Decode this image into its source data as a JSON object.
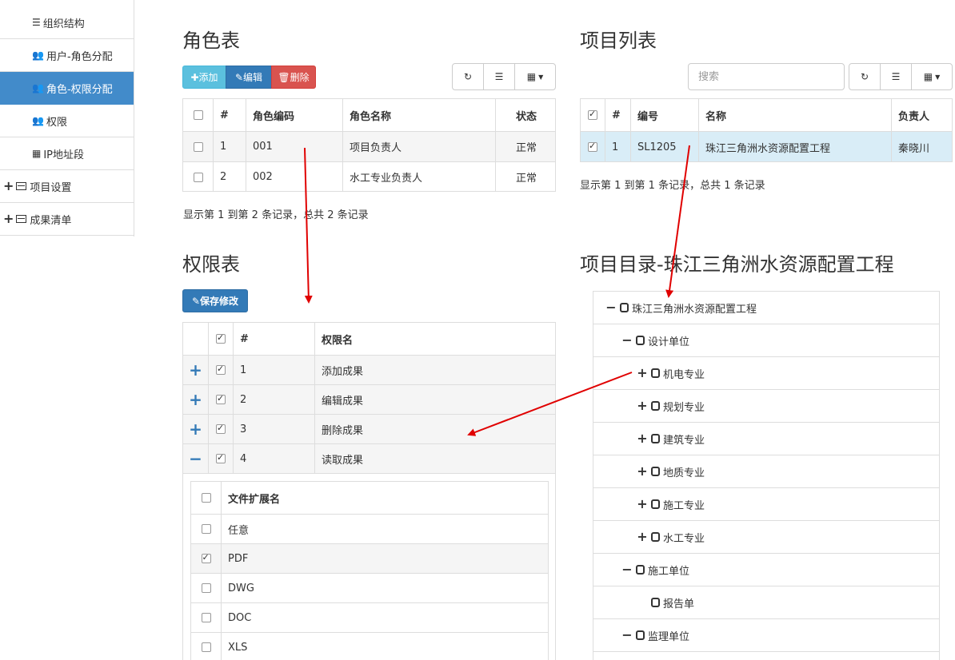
{
  "sidebar": {
    "items": [
      {
        "label": "组织结构",
        "icon": "list-icon"
      },
      {
        "label": "用户-角色分配",
        "icon": "users-icon"
      },
      {
        "label": "角色-权限分配",
        "icon": "users-icon"
      },
      {
        "label": "权限",
        "icon": "users-icon"
      },
      {
        "label": "IP地址段",
        "icon": "grid-icon"
      },
      {
        "label": "项目设置",
        "icon": "plus-icon"
      },
      {
        "label": "成果清单",
        "icon": "plus-icon"
      }
    ]
  },
  "role_section": {
    "title": "角色表",
    "add_label": "✚添加",
    "edit_label": "✎编辑",
    "delete_label": "🗑删除",
    "headers": [
      "#",
      "角色编码",
      "角色名称",
      "状态"
    ],
    "rows": [
      {
        "num": "1",
        "code": "001",
        "name": "项目负责人",
        "status": "正常"
      },
      {
        "num": "2",
        "code": "002",
        "name": "水工专业负责人",
        "status": "正常"
      }
    ],
    "footer": "显示第 1 到第 2 条记录，总共 2 条记录"
  },
  "project_section": {
    "title": "项目列表",
    "search_placeholder": "搜索",
    "headers": [
      "#",
      "编号",
      "名称",
      "负责人"
    ],
    "rows": [
      {
        "num": "1",
        "code": "SL1205",
        "name": "珠江三角洲水资源配置工程",
        "owner": "秦晓川"
      }
    ],
    "footer": "显示第 1 到第 1 条记录，总共 1 条记录"
  },
  "permission_section": {
    "title": "权限表",
    "save_label": "✎保存修改",
    "headers": [
      "#",
      "权限名"
    ],
    "rows": [
      {
        "expander": "+",
        "num": "1",
        "name": "添加成果"
      },
      {
        "expander": "+",
        "num": "2",
        "name": "编辑成果"
      },
      {
        "expander": "+",
        "num": "3",
        "name": "删除成果"
      },
      {
        "expander": "−",
        "num": "4",
        "name": "读取成果"
      }
    ],
    "ext_header": "文件扩展名",
    "ext_rows": [
      {
        "name": "任意",
        "checked": false
      },
      {
        "name": "PDF",
        "checked": true
      },
      {
        "name": "DWG",
        "checked": false
      },
      {
        "name": "DOC",
        "checked": false
      },
      {
        "name": "XLS",
        "checked": false
      }
    ]
  },
  "tree_section": {
    "title": "项目目录-珠江三角洲水资源配置工程",
    "nodes": [
      {
        "toggle": "−",
        "label": "珠江三角洲水资源配置工程"
      },
      {
        "toggle": "−",
        "label": "设计单位"
      },
      {
        "toggle": "+",
        "label": "机电专业"
      },
      {
        "toggle": "+",
        "label": "规划专业"
      },
      {
        "toggle": "+",
        "label": "建筑专业"
      },
      {
        "toggle": "+",
        "label": "地质专业"
      },
      {
        "toggle": "+",
        "label": "施工专业"
      },
      {
        "toggle": "+",
        "label": "水工专业"
      },
      {
        "toggle": "−",
        "label": "施工单位"
      },
      {
        "toggle": "",
        "label": "报告单"
      },
      {
        "toggle": "−",
        "label": "监理单位"
      }
    ]
  },
  "colors": {
    "primary": "#337ab7",
    "info": "#5bc0de",
    "danger": "#d9534f",
    "selected_row": "#d9edf7",
    "arrow": "#e00000"
  }
}
